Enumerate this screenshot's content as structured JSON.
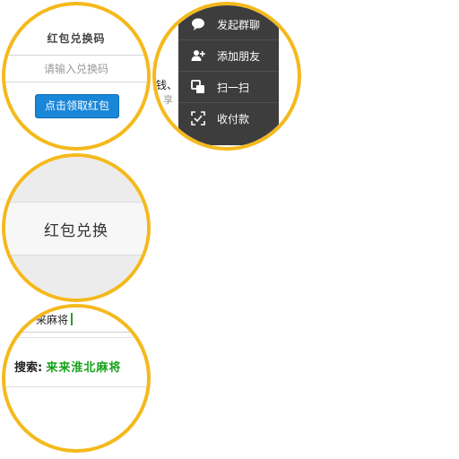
{
  "redeem_form": {
    "title": "红包兑换码",
    "input_placeholder": "请输入兑换码",
    "submit_label": "点击领取红包",
    "accent_color": "#1a86d8"
  },
  "popup_menu": {
    "background_text": "钱、安",
    "background_subtext": "享",
    "items": [
      {
        "label": "发起群聊",
        "icon": "chat-bubble-icon"
      },
      {
        "label": "添加朋友",
        "icon": "add-user-icon"
      },
      {
        "label": "扫一扫",
        "icon": "scan-icon"
      },
      {
        "label": "收付款",
        "icon": "payment-scan-icon"
      }
    ]
  },
  "redeem_header": {
    "title": "红包兑换"
  },
  "search": {
    "query": "来麻将",
    "result_label": "搜索:",
    "result_term": "来来淮北麻将",
    "highlight_color": "#16a31b"
  },
  "frame_color": "#f4b91c"
}
